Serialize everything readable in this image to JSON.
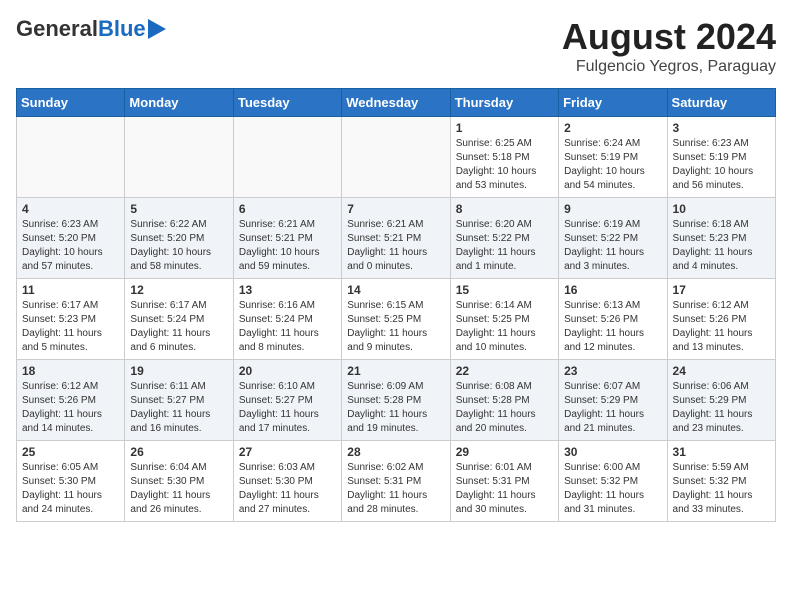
{
  "header": {
    "logo_general": "General",
    "logo_blue": "Blue",
    "title": "August 2024",
    "subtitle": "Fulgencio Yegros, Paraguay"
  },
  "weekdays": [
    "Sunday",
    "Monday",
    "Tuesday",
    "Wednesday",
    "Thursday",
    "Friday",
    "Saturday"
  ],
  "weeks": [
    [
      {
        "day": "",
        "info": ""
      },
      {
        "day": "",
        "info": ""
      },
      {
        "day": "",
        "info": ""
      },
      {
        "day": "",
        "info": ""
      },
      {
        "day": "1",
        "info": "Sunrise: 6:25 AM\nSunset: 5:18 PM\nDaylight: 10 hours\nand 53 minutes."
      },
      {
        "day": "2",
        "info": "Sunrise: 6:24 AM\nSunset: 5:19 PM\nDaylight: 10 hours\nand 54 minutes."
      },
      {
        "day": "3",
        "info": "Sunrise: 6:23 AM\nSunset: 5:19 PM\nDaylight: 10 hours\nand 56 minutes."
      }
    ],
    [
      {
        "day": "4",
        "info": "Sunrise: 6:23 AM\nSunset: 5:20 PM\nDaylight: 10 hours\nand 57 minutes."
      },
      {
        "day": "5",
        "info": "Sunrise: 6:22 AM\nSunset: 5:20 PM\nDaylight: 10 hours\nand 58 minutes."
      },
      {
        "day": "6",
        "info": "Sunrise: 6:21 AM\nSunset: 5:21 PM\nDaylight: 10 hours\nand 59 minutes."
      },
      {
        "day": "7",
        "info": "Sunrise: 6:21 AM\nSunset: 5:21 PM\nDaylight: 11 hours\nand 0 minutes."
      },
      {
        "day": "8",
        "info": "Sunrise: 6:20 AM\nSunset: 5:22 PM\nDaylight: 11 hours\nand 1 minute."
      },
      {
        "day": "9",
        "info": "Sunrise: 6:19 AM\nSunset: 5:22 PM\nDaylight: 11 hours\nand 3 minutes."
      },
      {
        "day": "10",
        "info": "Sunrise: 6:18 AM\nSunset: 5:23 PM\nDaylight: 11 hours\nand 4 minutes."
      }
    ],
    [
      {
        "day": "11",
        "info": "Sunrise: 6:17 AM\nSunset: 5:23 PM\nDaylight: 11 hours\nand 5 minutes."
      },
      {
        "day": "12",
        "info": "Sunrise: 6:17 AM\nSunset: 5:24 PM\nDaylight: 11 hours\nand 6 minutes."
      },
      {
        "day": "13",
        "info": "Sunrise: 6:16 AM\nSunset: 5:24 PM\nDaylight: 11 hours\nand 8 minutes."
      },
      {
        "day": "14",
        "info": "Sunrise: 6:15 AM\nSunset: 5:25 PM\nDaylight: 11 hours\nand 9 minutes."
      },
      {
        "day": "15",
        "info": "Sunrise: 6:14 AM\nSunset: 5:25 PM\nDaylight: 11 hours\nand 10 minutes."
      },
      {
        "day": "16",
        "info": "Sunrise: 6:13 AM\nSunset: 5:26 PM\nDaylight: 11 hours\nand 12 minutes."
      },
      {
        "day": "17",
        "info": "Sunrise: 6:12 AM\nSunset: 5:26 PM\nDaylight: 11 hours\nand 13 minutes."
      }
    ],
    [
      {
        "day": "18",
        "info": "Sunrise: 6:12 AM\nSunset: 5:26 PM\nDaylight: 11 hours\nand 14 minutes."
      },
      {
        "day": "19",
        "info": "Sunrise: 6:11 AM\nSunset: 5:27 PM\nDaylight: 11 hours\nand 16 minutes."
      },
      {
        "day": "20",
        "info": "Sunrise: 6:10 AM\nSunset: 5:27 PM\nDaylight: 11 hours\nand 17 minutes."
      },
      {
        "day": "21",
        "info": "Sunrise: 6:09 AM\nSunset: 5:28 PM\nDaylight: 11 hours\nand 19 minutes."
      },
      {
        "day": "22",
        "info": "Sunrise: 6:08 AM\nSunset: 5:28 PM\nDaylight: 11 hours\nand 20 minutes."
      },
      {
        "day": "23",
        "info": "Sunrise: 6:07 AM\nSunset: 5:29 PM\nDaylight: 11 hours\nand 21 minutes."
      },
      {
        "day": "24",
        "info": "Sunrise: 6:06 AM\nSunset: 5:29 PM\nDaylight: 11 hours\nand 23 minutes."
      }
    ],
    [
      {
        "day": "25",
        "info": "Sunrise: 6:05 AM\nSunset: 5:30 PM\nDaylight: 11 hours\nand 24 minutes."
      },
      {
        "day": "26",
        "info": "Sunrise: 6:04 AM\nSunset: 5:30 PM\nDaylight: 11 hours\nand 26 minutes."
      },
      {
        "day": "27",
        "info": "Sunrise: 6:03 AM\nSunset: 5:30 PM\nDaylight: 11 hours\nand 27 minutes."
      },
      {
        "day": "28",
        "info": "Sunrise: 6:02 AM\nSunset: 5:31 PM\nDaylight: 11 hours\nand 28 minutes."
      },
      {
        "day": "29",
        "info": "Sunrise: 6:01 AM\nSunset: 5:31 PM\nDaylight: 11 hours\nand 30 minutes."
      },
      {
        "day": "30",
        "info": "Sunrise: 6:00 AM\nSunset: 5:32 PM\nDaylight: 11 hours\nand 31 minutes."
      },
      {
        "day": "31",
        "info": "Sunrise: 5:59 AM\nSunset: 5:32 PM\nDaylight: 11 hours\nand 33 minutes."
      }
    ]
  ]
}
